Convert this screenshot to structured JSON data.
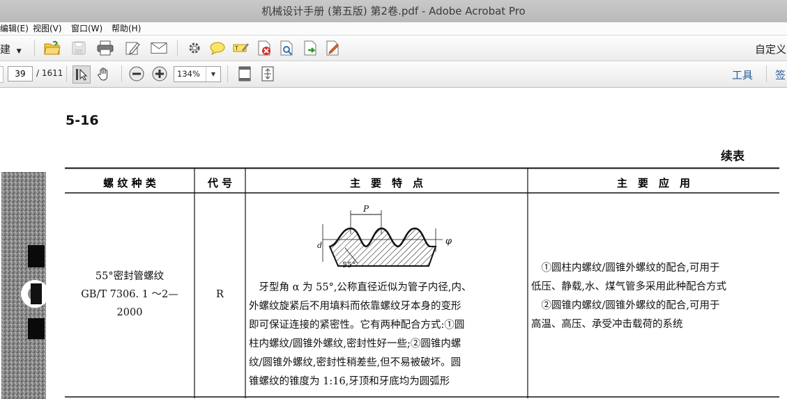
{
  "window": {
    "title": "机械设计手册 (第五版) 第2卷.pdf - Adobe Acrobat Pro"
  },
  "menu": {
    "items": [
      "编辑(E)",
      "视图(V)",
      "窗口(W)",
      "帮助(H)"
    ]
  },
  "toolbar": {
    "create_label": "建",
    "customize_label": "自定义",
    "icons": [
      "open-folder",
      "save",
      "print",
      "edit",
      "email",
      "settings",
      "comment",
      "highlight",
      "pdf-action",
      "review",
      "export",
      "sign"
    ]
  },
  "nav": {
    "page_value": "39",
    "page_total": "/ 1611",
    "zoom_value": "134%",
    "tools_label": "工具",
    "sign_label": "签"
  },
  "document": {
    "page_number": "5-16",
    "continued_label": "续表",
    "table": {
      "headers": [
        "螺 纹 种 类",
        "代 号",
        "主　要　特　点",
        "主　要　应　用"
      ],
      "row": {
        "type_lines": [
          "55°密封管螺纹",
          "GB/T 7306. 1 ～2—",
          "2000"
        ],
        "code": "R",
        "figure_labels": {
          "pitch": "P",
          "diameter": "d",
          "angle": "55°",
          "phi": "φ"
        },
        "features_lines": [
          "　牙型角 α 为 55°,公称直径近似为管子内径,内、",
          "外螺纹旋紧后不用填料而依靠螺纹牙本身的变形",
          "即可保证连接的紧密性。它有两种配合方式:①圆",
          "柱内螺纹/圆锥外螺纹,密封性好一些;②圆锥内螺",
          "纹/圆锥外螺纹,密封性稍差些,但不易被破坏。圆",
          "锥螺纹的锥度为 1:16,牙顶和牙底均为圆弧形"
        ],
        "application_lines": [
          "　①圆柱内螺纹/圆锥外螺纹的配合,可用于",
          "低压、静载,水、煤气管多采用此种配合方式",
          "　②圆锥内螺纹/圆锥外螺纹的配合,可用于",
          "高温、高压、承受冲击载荷的系统"
        ]
      }
    }
  }
}
